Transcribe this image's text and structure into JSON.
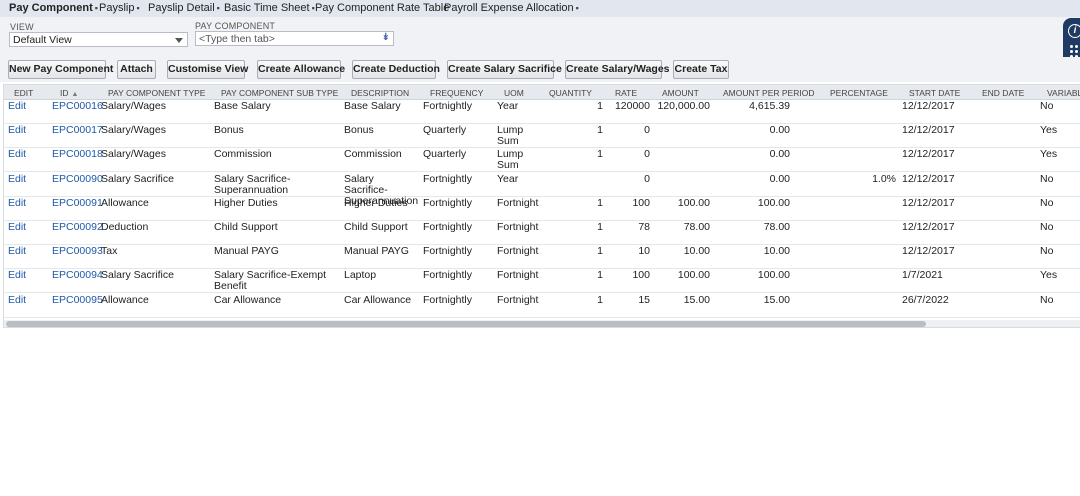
{
  "tabs": [
    {
      "label": "Pay Component",
      "dot": "▪"
    },
    {
      "label": "Payslip",
      "dot": "▪"
    },
    {
      "label": "Payslip Detail",
      "dot": "▪"
    },
    {
      "label": "Basic Time Sheet",
      "dot": "▪"
    },
    {
      "label": "Pay Component Rate Table",
      "dot": ""
    },
    {
      "label": "Payroll Expense Allocation",
      "dot": "▪"
    }
  ],
  "filters": {
    "view_label": "VIEW",
    "view_value": "Default View",
    "pay_component_label": "PAY COMPONENT",
    "pay_component_placeholder": "<Type then tab>"
  },
  "buttons": {
    "new": "New Pay Component",
    "attach": "Attach",
    "customise": "Customise View",
    "allowance": "Create Allowance",
    "deduction": "Create Deduction",
    "salary_sacrifice": "Create Salary Sacrifice",
    "salary_wages": "Create Salary/Wages",
    "tax": "Create Tax"
  },
  "table": {
    "headers": {
      "edit": "EDIT",
      "id": "ID",
      "sort": "▲",
      "type": "PAY COMPONENT TYPE",
      "subtype": "PAY COMPONENT SUB TYPE",
      "description": "DESCRIPTION",
      "frequency": "FREQUENCY",
      "uom": "UOM",
      "quantity": "QUANTITY",
      "rate": "RATE",
      "amount": "AMOUNT",
      "amount_per_period": "AMOUNT PER PERIOD",
      "percentage": "PERCENTAGE",
      "start_date": "START DATE",
      "end_date": "END DATE",
      "variable": "VARIABLE"
    },
    "rows": [
      {
        "edit": "Edit",
        "id": "EPC00016",
        "type": "Salary/Wages",
        "subtype": "Base Salary",
        "description": "Base Salary",
        "frequency": "Fortnightly",
        "uom": "Year",
        "quantity": "1",
        "rate": "120000",
        "amount": "120,000.00",
        "amount_per_period": "4,615.39",
        "percentage": "",
        "start_date": "12/12/2017",
        "end_date": "",
        "variable": "No"
      },
      {
        "edit": "Edit",
        "id": "EPC00017",
        "type": "Salary/Wages",
        "subtype": "Bonus",
        "description": "Bonus",
        "frequency": "Quarterly",
        "uom": "Lump Sum",
        "quantity": "1",
        "rate": "0",
        "amount": "",
        "amount_per_period": "0.00",
        "percentage": "",
        "start_date": "12/12/2017",
        "end_date": "",
        "variable": "Yes"
      },
      {
        "edit": "Edit",
        "id": "EPC00018",
        "type": "Salary/Wages",
        "subtype": "Commission",
        "description": "Commission",
        "frequency": "Quarterly",
        "uom": "Lump Sum",
        "quantity": "1",
        "rate": "0",
        "amount": "",
        "amount_per_period": "0.00",
        "percentage": "",
        "start_date": "12/12/2017",
        "end_date": "",
        "variable": "Yes"
      },
      {
        "edit": "Edit",
        "id": "EPC00090",
        "type": "Salary Sacrifice",
        "subtype": "Salary Sacrifice-Superannuation",
        "description": "Salary Sacrifice-Superannuation",
        "frequency": "Fortnightly",
        "uom": "Year",
        "quantity": "",
        "rate": "0",
        "amount": "",
        "amount_per_period": "0.00",
        "percentage": "1.0%",
        "start_date": "12/12/2017",
        "end_date": "",
        "variable": "No"
      },
      {
        "edit": "Edit",
        "id": "EPC00091",
        "type": "Allowance",
        "subtype": "Higher Duties",
        "description": "Higher Duties",
        "frequency": "Fortnightly",
        "uom": "Fortnight",
        "quantity": "1",
        "rate": "100",
        "amount": "100.00",
        "amount_per_period": "100.00",
        "percentage": "",
        "start_date": "12/12/2017",
        "end_date": "",
        "variable": "No"
      },
      {
        "edit": "Edit",
        "id": "EPC00092",
        "type": "Deduction",
        "subtype": "Child Support",
        "description": "Child Support",
        "frequency": "Fortnightly",
        "uom": "Fortnight",
        "quantity": "1",
        "rate": "78",
        "amount": "78.00",
        "amount_per_period": "78.00",
        "percentage": "",
        "start_date": "12/12/2017",
        "end_date": "",
        "variable": "No"
      },
      {
        "edit": "Edit",
        "id": "EPC00093",
        "type": "Tax",
        "subtype": "Manual PAYG",
        "description": "Manual PAYG",
        "frequency": "Fortnightly",
        "uom": "Fortnight",
        "quantity": "1",
        "rate": "10",
        "amount": "10.00",
        "amount_per_period": "10.00",
        "percentage": "",
        "start_date": "12/12/2017",
        "end_date": "",
        "variable": "No"
      },
      {
        "edit": "Edit",
        "id": "EPC00094",
        "type": "Salary Sacrifice",
        "subtype": "Salary Sacrifice-Exempt Benefit",
        "description": "Laptop",
        "frequency": "Fortnightly",
        "uom": "Fortnight",
        "quantity": "1",
        "rate": "100",
        "amount": "100.00",
        "amount_per_period": "100.00",
        "percentage": "",
        "start_date": "1/7/2021",
        "end_date": "",
        "variable": "Yes"
      },
      {
        "edit": "Edit",
        "id": "EPC00095",
        "type": "Allowance",
        "subtype": "Car Allowance",
        "description": "Car Allowance",
        "frequency": "Fortnightly",
        "uom": "Fortnight",
        "quantity": "1",
        "rate": "15",
        "amount": "15.00",
        "amount_per_period": "15.00",
        "percentage": "",
        "start_date": "26/7/2022",
        "end_date": "",
        "variable": "No"
      }
    ]
  },
  "side_widget": {
    "info_icon": "i",
    "icon_names": [
      "info-icon",
      "grid-icon"
    ]
  },
  "colors": {
    "link": "#1e5aa8",
    "tabbar": "#e1e6ef",
    "header": "#e6e9ee",
    "widget": "#1f3b63"
  }
}
